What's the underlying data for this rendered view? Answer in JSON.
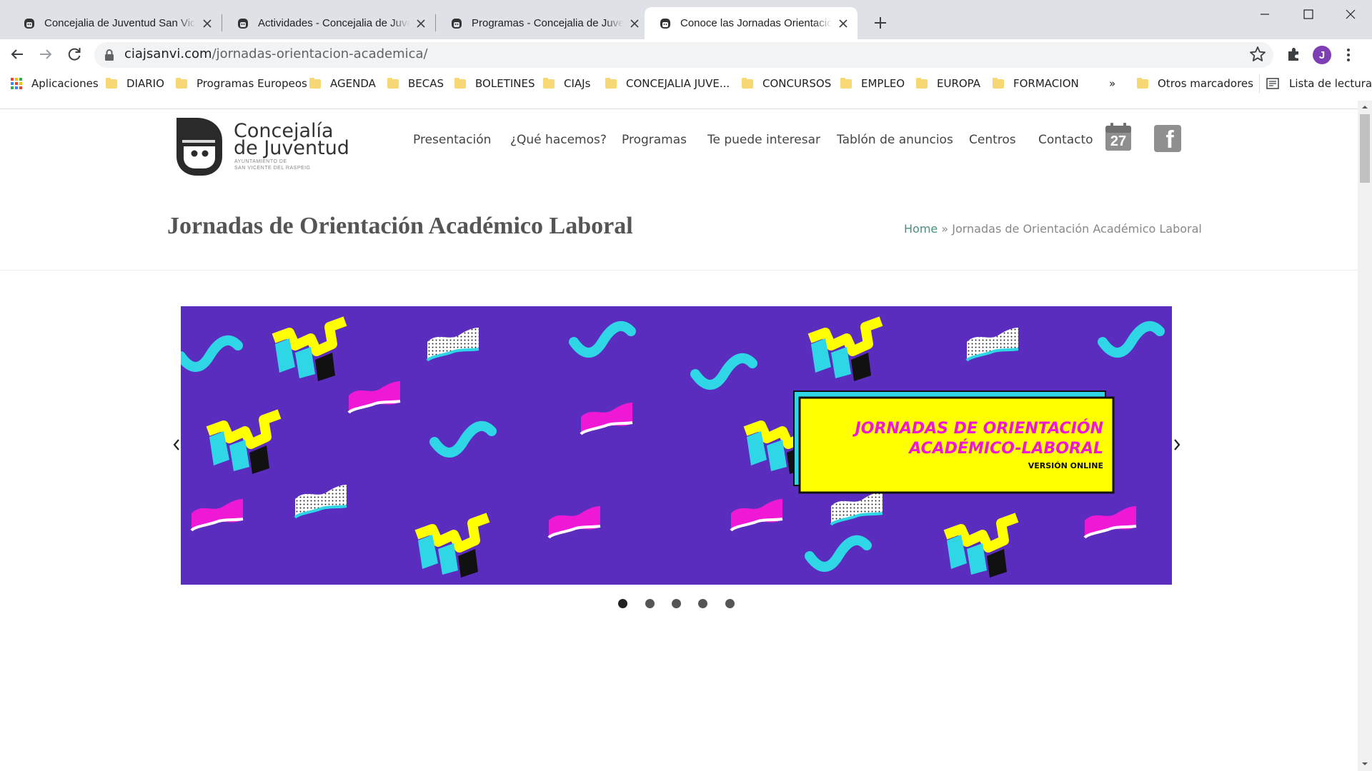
{
  "browser": {
    "tabs": [
      {
        "title": "Concejalia de Juventud San Vicente del Raspeig",
        "active": false
      },
      {
        "title": "Actividades - Concejalia de Juventud",
        "active": false
      },
      {
        "title": "Programas - Concejalia de Juventud",
        "active": false
      },
      {
        "title": "Conoce las Jornadas Orientación Académico Laboral",
        "active": true
      }
    ],
    "url_domain": "ciajsanvi.com",
    "url_path": "/jornadas-orientacion-academica/",
    "avatar_letter": "J",
    "bookmarks": [
      {
        "label": "Aplicaciones",
        "icon": "apps-grid-icon"
      },
      {
        "label": "DIARIO",
        "icon": "folder-icon"
      },
      {
        "label": "Programas Europeos",
        "icon": "folder-icon"
      },
      {
        "label": "AGENDA",
        "icon": "folder-icon"
      },
      {
        "label": "BECAS",
        "icon": "folder-icon"
      },
      {
        "label": "BOLETINES",
        "icon": "folder-icon"
      },
      {
        "label": "CIAJs",
        "icon": "folder-icon"
      },
      {
        "label": "CONCEJALIA JUVE...",
        "icon": "folder-icon"
      },
      {
        "label": "CONCURSOS",
        "icon": "folder-icon"
      },
      {
        "label": "EMPLEO",
        "icon": "folder-icon"
      },
      {
        "label": "EUROPA",
        "icon": "folder-icon"
      },
      {
        "label": "FORMACION",
        "icon": "folder-icon"
      }
    ],
    "bookmarks_overflow": "»",
    "other_bookmarks": "Otros marcadores",
    "reading_list": "Lista de lectura"
  },
  "site": {
    "logo": {
      "line1": "Concejalía",
      "line2": "de Juventud",
      "line3": "AYUNTAMIENTO DE",
      "line4": "SAN VICENTE DEL RASPEIG"
    },
    "nav": [
      "Presentación",
      "¿Qué hacemos?",
      "Programas",
      "Te puede interesar",
      "Tablón de anuncios",
      "Centros",
      "Contacto"
    ],
    "calendar_day": "27",
    "facebook_glyph": "f"
  },
  "page": {
    "title": "Jornadas de Orientación Académico Laboral",
    "breadcrumb_home": "Home",
    "breadcrumb_sep": "»",
    "breadcrumb_current": "Jornadas de Orientación Académico Laboral"
  },
  "banner": {
    "heading_line1": "JORNADAS DE ORIENTACIÓN",
    "heading_line2": "ACADÉMICO-LABORAL",
    "subheading": "VERSIÓN ONLINE",
    "slide_count": 5,
    "active_slide": 1
  },
  "colors": {
    "banner_bg": "#5a2dbf",
    "banner_yellow": "#ffff00",
    "banner_cyan": "#2fd6e6",
    "banner_magenta": "#ef18d5",
    "breadcrumb_link": "#4d8f80"
  }
}
